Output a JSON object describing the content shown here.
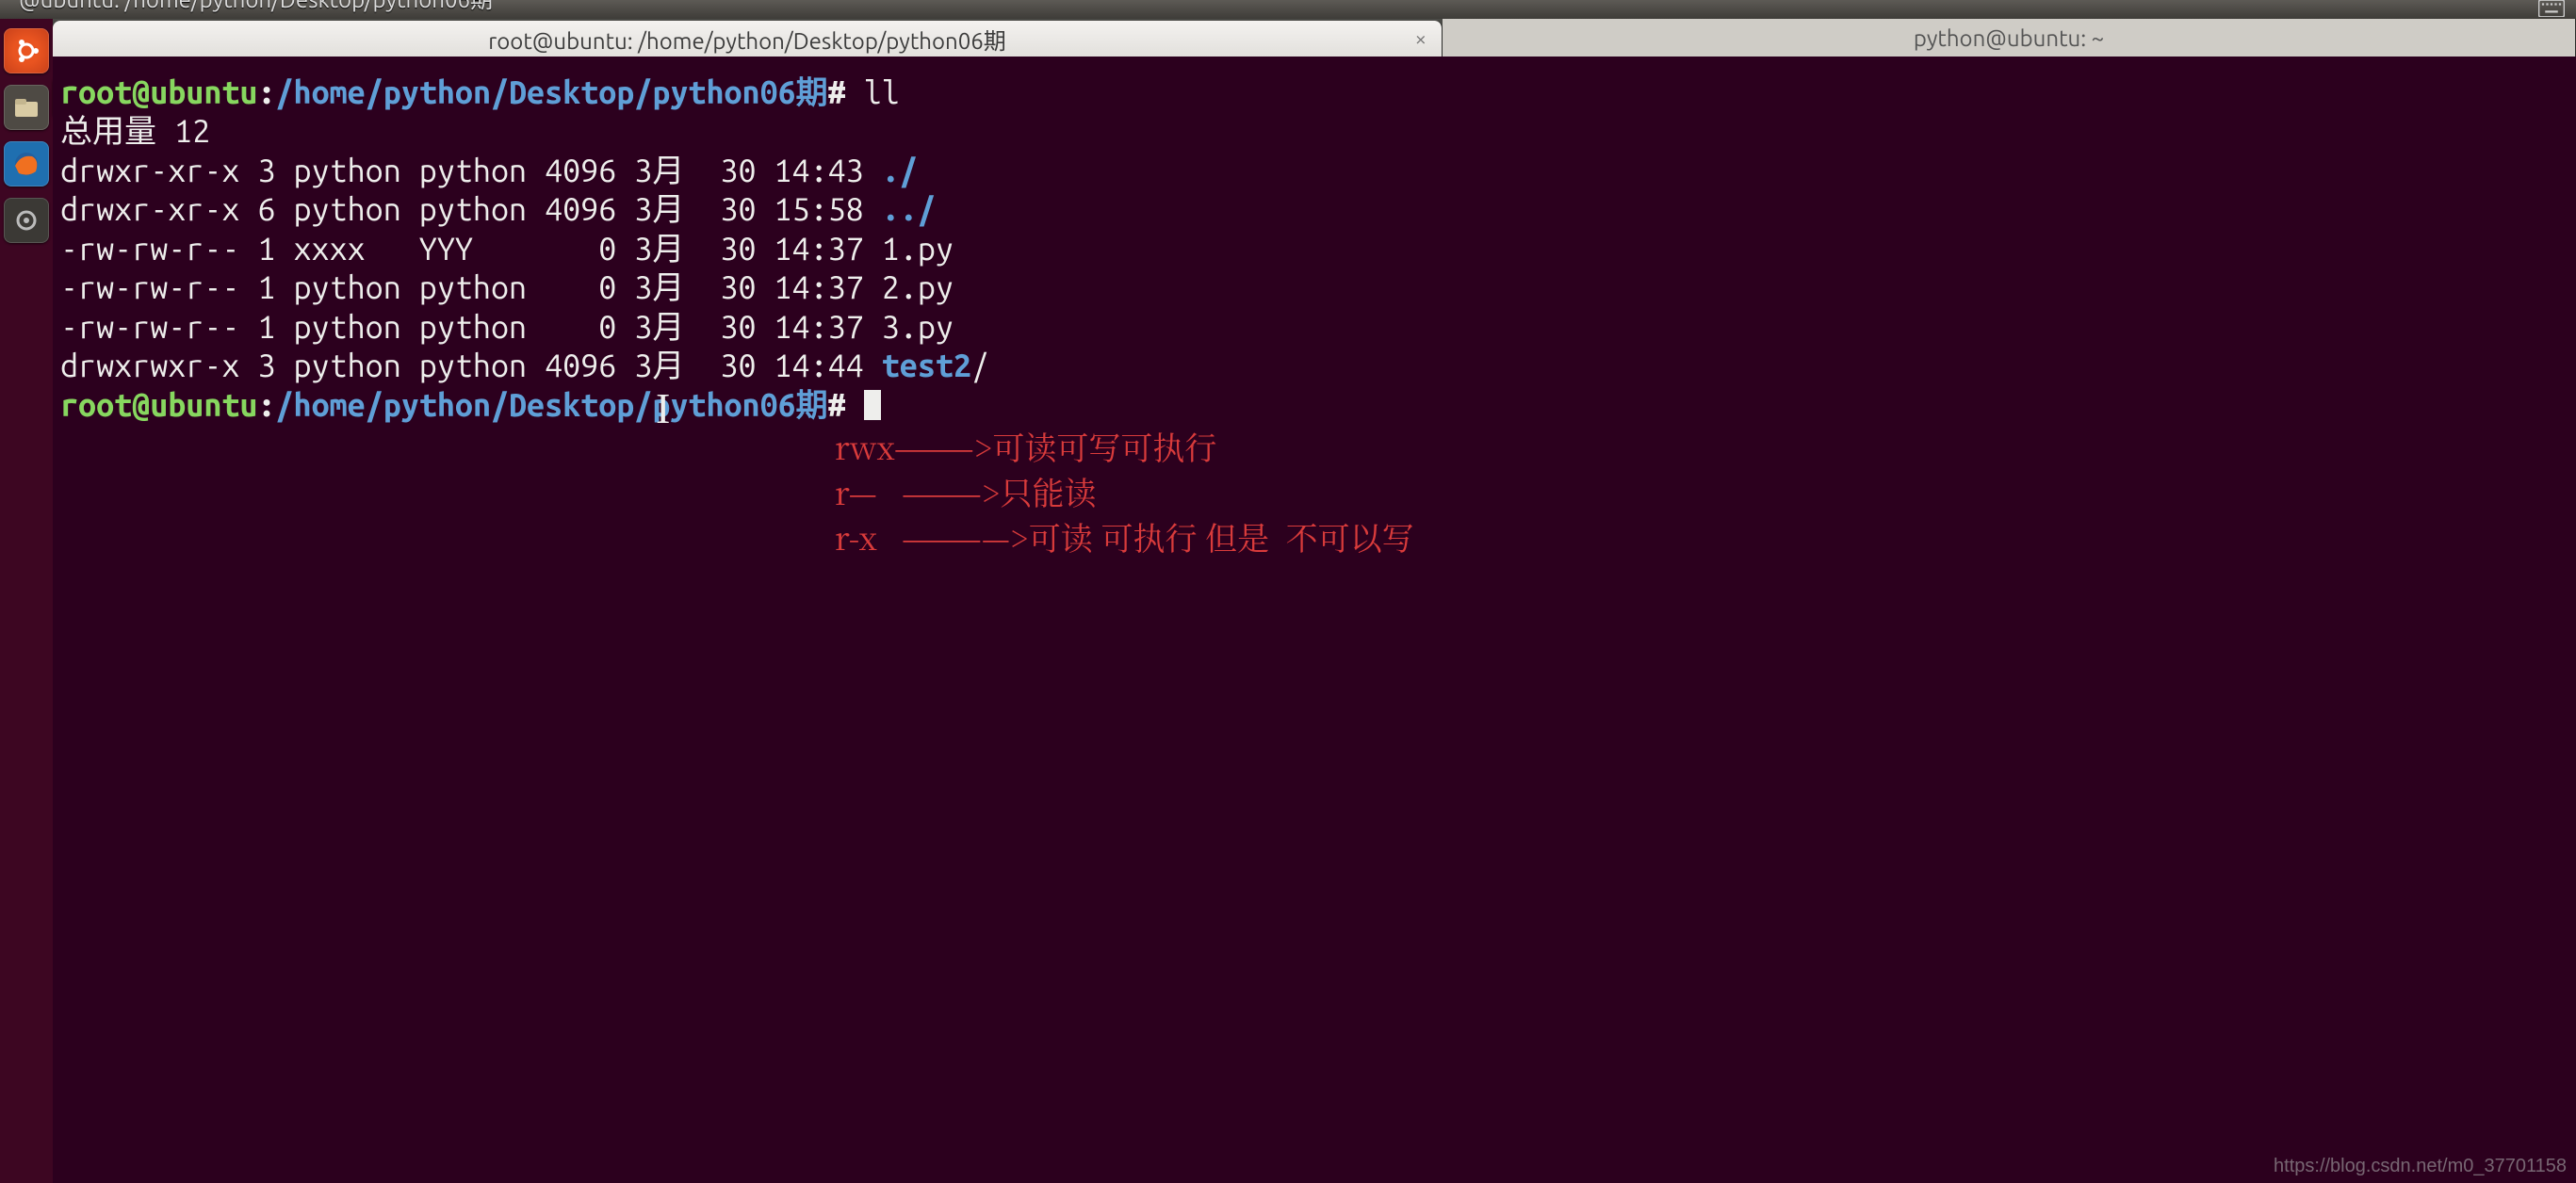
{
  "window": {
    "top_title": "@ubuntu: /home/python/Desktop/python06期"
  },
  "tabs": {
    "active": {
      "label": "root@ubuntu: /home/python/Desktop/python06期",
      "close": "×"
    },
    "inactive": {
      "label": "python@ubuntu: ~"
    }
  },
  "prompt1": {
    "user": "root@ubuntu",
    "colon": ":",
    "path": "/home/python/Desktop/python06期",
    "hash": "#",
    "cmd": " ll"
  },
  "lines": {
    "total": "总用量 12",
    "l1": "drwxr-xr-x 3 python python 4096 3月  30 14:43 ",
    "l1dir": "./",
    "l2": "drwxr-xr-x 6 python python 4096 3月  30 15:58 ",
    "l2dir": "../",
    "l3": "-rw-rw-r-- 1 xxxx   YYY       0 3月  30 14:37 1.py",
    "l4": "-rw-rw-r-- 1 python python    0 3月  30 14:37 2.py",
    "l5": "-rw-rw-r-- 1 python python    0 3月  30 14:37 3.py",
    "l6": "drwxrwxr-x 3 python python 4096 3月  30 14:44 ",
    "l6dir": "test2",
    "l6slash": "/"
  },
  "prompt2": {
    "user": "root@ubuntu",
    "colon": ":",
    "path": "/home/python/Desktop/python06期",
    "hash": "# "
  },
  "annotations": {
    "a1": "rwx———>可读可写可执行",
    "a2": "r—   ———>只能读",
    "a3": "r-x   ————>可读 可执行 但是  不可以写"
  },
  "watermark": "https://blog.csdn.net/m0_37701158"
}
